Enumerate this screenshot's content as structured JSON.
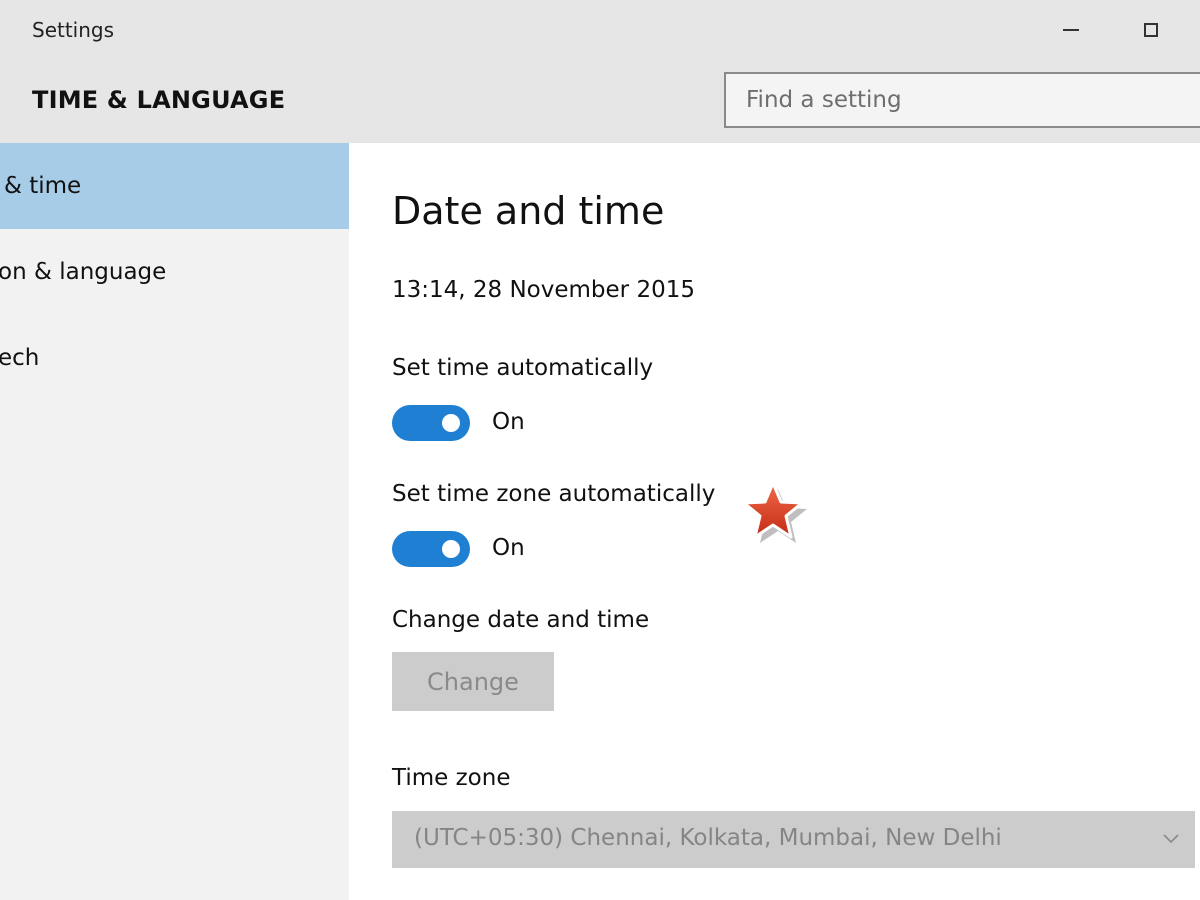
{
  "window": {
    "title": "Settings",
    "controls": [
      "minimize-icon",
      "maximize-icon"
    ]
  },
  "header": {
    "section_title": "TIME & LANGUAGE",
    "search_placeholder": "Find a setting"
  },
  "sidebar": {
    "items": [
      {
        "label": "& time",
        "selected": true
      },
      {
        "label": "on & language",
        "selected": false
      },
      {
        "label": "ech",
        "selected": false
      }
    ]
  },
  "main": {
    "title": "Date and time",
    "current_datetime": "13:14, 28 November 2015",
    "set_time_auto": {
      "label": "Set time automatically",
      "state": "On"
    },
    "set_timezone_auto": {
      "label": "Set time zone automatically",
      "state": "On"
    },
    "change_section": {
      "label": "Change date and time",
      "button": "Change"
    },
    "timezone": {
      "label": "Time zone",
      "value": "(UTC+05:30) Chennai, Kolkata, Mumbai, New Delhi"
    }
  },
  "colors": {
    "accent": "#1f80d3",
    "selected_nav": "#a7cce7",
    "chrome": "#e6e6e6",
    "annotation_star": "#d83a22"
  },
  "annotation": {
    "icon": "star-icon"
  }
}
